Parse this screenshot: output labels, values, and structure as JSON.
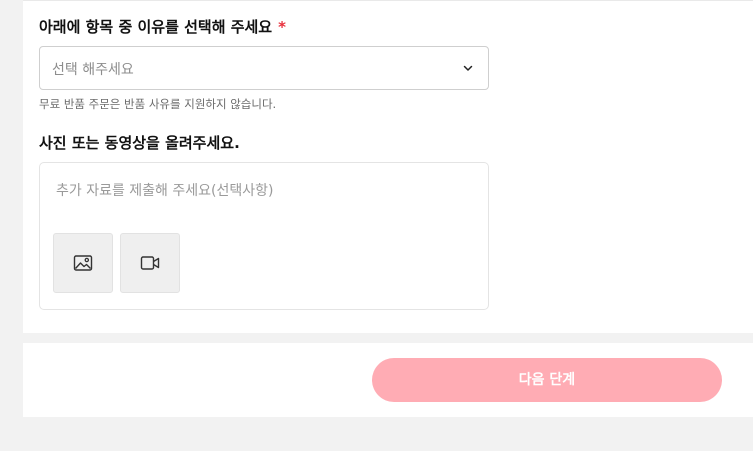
{
  "reason_section": {
    "label": "아래에 항목 중 이유를 선택해 주세요",
    "required_mark": "*",
    "select_placeholder": "선택 해주세요",
    "helper_text": "무료 반품 주문은 반품 사유를 지원하지 않습니다."
  },
  "media_section": {
    "label": "사진 또는 동영상을 올려주세요.",
    "textarea_placeholder": "추가 자료를 제출해 주세요(선택사항)",
    "buttons": [
      {
        "icon": "image-icon"
      },
      {
        "icon": "video-icon"
      }
    ]
  },
  "footer": {
    "next_label": "다음 단계",
    "next_color": "#ffacb4",
    "next_state": "disabled"
  },
  "colors": {
    "required": "#e8303d",
    "background": "#f2f2f2"
  }
}
